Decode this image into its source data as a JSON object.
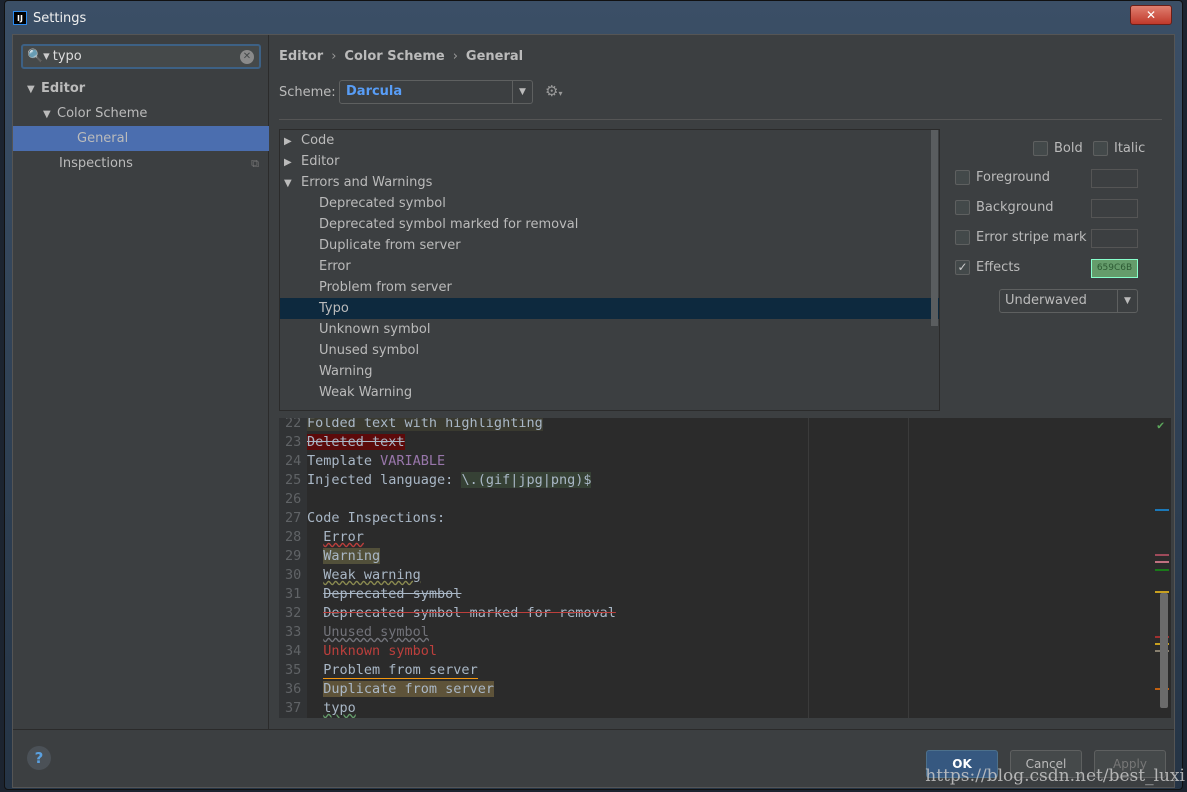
{
  "window": {
    "title": "Settings",
    "logo": "IJ",
    "close": "✕"
  },
  "search": {
    "value": "typo"
  },
  "sidebar": {
    "items": [
      {
        "label": "Editor",
        "level": 0,
        "expanded": true
      },
      {
        "label": "Color Scheme",
        "level": 1,
        "expanded": true
      },
      {
        "label": "General",
        "level": 2,
        "selected": true
      },
      {
        "label": "Inspections",
        "level": 1
      }
    ]
  },
  "breadcrumb": [
    "Editor",
    "Color Scheme",
    "General"
  ],
  "scheme": {
    "label": "Scheme:",
    "value": "Darcula"
  },
  "tree": [
    {
      "label": "Code",
      "type": "collapsed"
    },
    {
      "label": "Editor",
      "type": "collapsed"
    },
    {
      "label": "Errors and Warnings",
      "type": "expanded"
    },
    {
      "label": "Deprecated symbol",
      "type": "child"
    },
    {
      "label": "Deprecated symbol marked for removal",
      "type": "child"
    },
    {
      "label": "Duplicate from server",
      "type": "child"
    },
    {
      "label": "Error",
      "type": "child"
    },
    {
      "label": "Problem from server",
      "type": "child"
    },
    {
      "label": "Typo",
      "type": "child",
      "selected": true
    },
    {
      "label": "Unknown symbol",
      "type": "child"
    },
    {
      "label": "Unused symbol",
      "type": "child"
    },
    {
      "label": "Warning",
      "type": "child"
    },
    {
      "label": "Weak Warning",
      "type": "child"
    }
  ],
  "options": {
    "bold": {
      "label": "Bold",
      "checked": false
    },
    "italic": {
      "label": "Italic",
      "checked": false
    },
    "foreground": {
      "label": "Foreground",
      "checked": false
    },
    "background": {
      "label": "Background",
      "checked": false
    },
    "error_stripe": {
      "label": "Error stripe mark",
      "checked": false
    },
    "effects": {
      "label": "Effects",
      "checked": true,
      "color": "659C6B"
    },
    "effect_type": "Underwaved"
  },
  "preview": [
    {
      "n": "22",
      "segs": [
        {
          "t": "Folded text with highlighting",
          "c": "#a9b7c6",
          "bg": "#3a3a30"
        }
      ]
    },
    {
      "n": "23",
      "segs": [
        {
          "t": "Deleted text",
          "c": "#a9b7c6",
          "bg": "#5c0a0a",
          "deco": "line-through"
        }
      ]
    },
    {
      "n": "24",
      "segs": [
        {
          "t": "Template ",
          "c": "#a9b7c6"
        },
        {
          "t": "VARIABLE",
          "c": "#9876aa"
        }
      ]
    },
    {
      "n": "25",
      "segs": [
        {
          "t": "Injected language: ",
          "c": "#a9b7c6"
        },
        {
          "t": "\\.(gif|jpg|png)$",
          "c": "#a9b7c6",
          "bg": "#364135"
        }
      ]
    },
    {
      "n": "26",
      "segs": []
    },
    {
      "n": "27",
      "segs": [
        {
          "t": "Code Inspections:",
          "c": "#a9b7c6"
        }
      ]
    },
    {
      "n": "28",
      "segs": [
        {
          "t": "  "
        },
        {
          "t": "Error",
          "c": "#a9b7c6",
          "wave": "#bc3f3c"
        }
      ]
    },
    {
      "n": "29",
      "segs": [
        {
          "t": "  "
        },
        {
          "t": "Warning",
          "c": "#a9b7c6",
          "bg": "#52503a"
        }
      ]
    },
    {
      "n": "30",
      "segs": [
        {
          "t": "  "
        },
        {
          "t": "Weak warning",
          "c": "#a9b7c6",
          "wave": "#8a8a50"
        }
      ]
    },
    {
      "n": "31",
      "segs": [
        {
          "t": "  "
        },
        {
          "t": "Deprecated symbol",
          "c": "#a9b7c6",
          "deco": "line-through"
        }
      ]
    },
    {
      "n": "32",
      "segs": [
        {
          "t": "  "
        },
        {
          "t": "Deprecated symbol marked for removal",
          "c": "#a9b7c6",
          "deco": "line-through",
          "dc": "#bc3f3c"
        }
      ]
    },
    {
      "n": "33",
      "segs": [
        {
          "t": "  "
        },
        {
          "t": "Unused symbol",
          "c": "#72737a",
          "wave": "#72737a"
        }
      ]
    },
    {
      "n": "34",
      "segs": [
        {
          "t": "  "
        },
        {
          "t": "Unknown symbol",
          "c": "#bc3f3c"
        }
      ]
    },
    {
      "n": "35",
      "segs": [
        {
          "t": "  "
        },
        {
          "t": "Problem from server",
          "c": "#a9b7c6",
          "under": "#f49810"
        }
      ]
    },
    {
      "n": "36",
      "segs": [
        {
          "t": "  "
        },
        {
          "t": "Duplicate from server",
          "c": "#a9b7c6",
          "bg": "#5e5339"
        }
      ]
    },
    {
      "n": "37",
      "segs": [
        {
          "t": "  "
        },
        {
          "t": "typo",
          "c": "#a9b7c6",
          "wave": "#659c6b"
        }
      ]
    }
  ],
  "stripe_marks": [
    "#1b78b8",
    "#9e4a5a",
    "#c07080",
    "#1a7a1a",
    "#c8a020",
    "#a03030",
    "#c8a020",
    "#888070",
    "#c06010"
  ],
  "footer": {
    "help": "?",
    "ok": "OK",
    "cancel": "Cancel",
    "apply": "Apply"
  },
  "watermark": "https://blog.csdn.net/best_luxi"
}
